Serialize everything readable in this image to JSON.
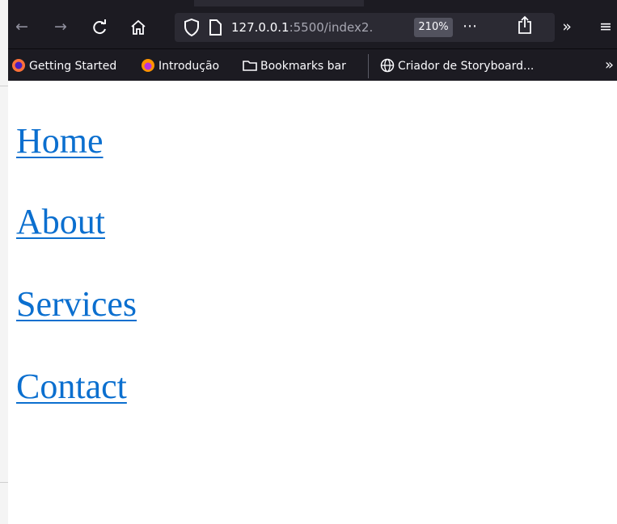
{
  "browser": {
    "url_host": "127.0.0.1",
    "url_rest": ":5500/index2.",
    "zoom": "210%",
    "bookmarks": [
      {
        "label": "Getting Started"
      },
      {
        "label": "Introdução"
      },
      {
        "label": "Bookmarks bar"
      },
      {
        "label": "Criador de Storyboard..."
      }
    ],
    "icons": {
      "back": "back-arrow-icon",
      "forward": "forward-arrow-icon",
      "reload": "reload-icon",
      "home": "home-icon",
      "shield": "shield-icon",
      "page": "page-icon",
      "more": "more-dots-icon",
      "share": "share-icon",
      "overflow": "chevron-double-right-icon",
      "menu": "hamburger-menu-icon"
    }
  },
  "page": {
    "links": [
      {
        "label": "Home"
      },
      {
        "label": "About"
      },
      {
        "label": "Services"
      },
      {
        "label": "Contact"
      }
    ]
  },
  "colors": {
    "chrome_bg": "#1c1b22",
    "urlbar_bg": "#2b2a33",
    "link": "#0b6fcf"
  }
}
